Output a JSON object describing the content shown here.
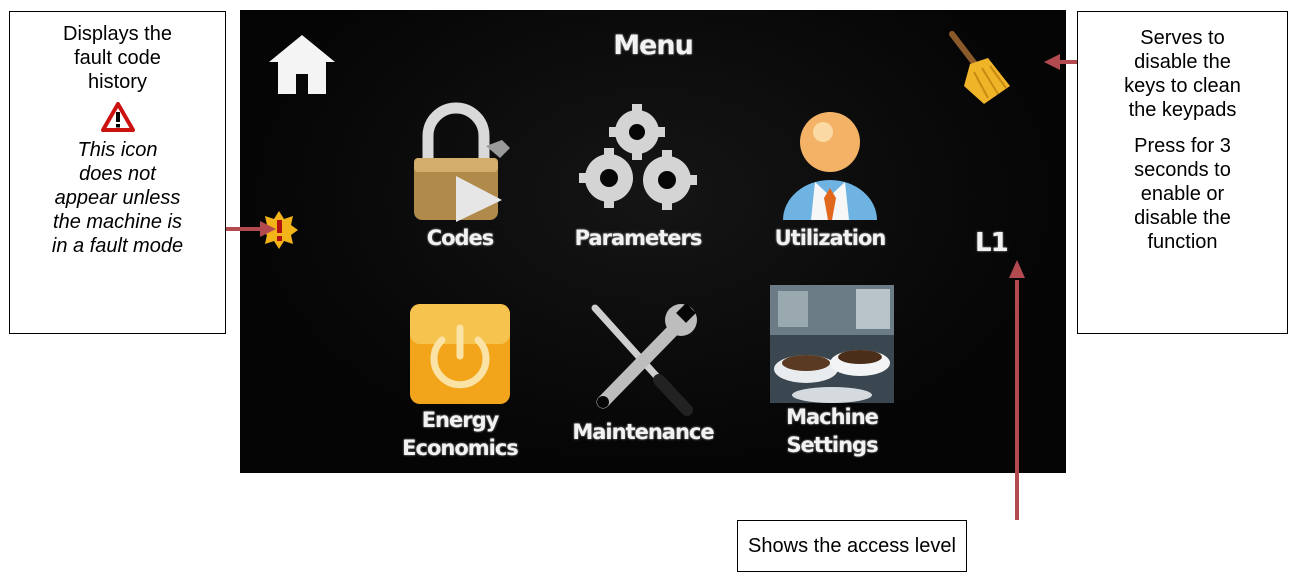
{
  "screen": {
    "title": "Menu",
    "access_level": "L1",
    "items": [
      {
        "label": "Codes"
      },
      {
        "label": "Parameters"
      },
      {
        "label": "Utilization"
      },
      {
        "label_line1": "Energy",
        "label_line2": "Economics"
      },
      {
        "label": "Maintenance"
      },
      {
        "label_line1": "Machine",
        "label_line2": "Settings"
      }
    ],
    "icons": {
      "home": "home-icon",
      "clean": "broom-icon",
      "fault": "fault-alert-icon"
    }
  },
  "callouts": {
    "left": {
      "line1": "Displays the",
      "line2": "fault code",
      "line3": "history",
      "note1": "This icon",
      "note2": "does not",
      "note3": "appear unless",
      "note4": "the machine is",
      "note5": "in a fault mode"
    },
    "right": {
      "line1": "Serves to",
      "line2": "disable the",
      "line3": "keys to clean",
      "line4": "the keypads",
      "line5": "Press for 3",
      "line6": "seconds to",
      "line7": "enable or",
      "line8": "disable the",
      "line9": "function"
    },
    "bottom": {
      "text": "Shows the access level"
    }
  },
  "colors": {
    "arrow": "#b24a4f",
    "screen_bg": "#060606",
    "energy_tile": "#f2a51a",
    "warning_red": "#cc1111"
  }
}
